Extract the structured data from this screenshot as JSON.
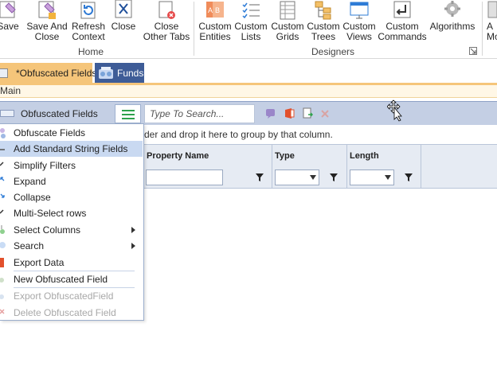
{
  "ribbon": {
    "buttons": [
      {
        "id": "save",
        "label": "Save",
        "icon": "save-icon"
      },
      {
        "id": "save-close",
        "label": "Save And Close",
        "icon": "save-close-icon"
      },
      {
        "id": "refresh",
        "label": "Refresh Context",
        "icon": "refresh-icon"
      },
      {
        "id": "close",
        "label": "Close",
        "icon": "close-icon"
      },
      {
        "id": "close-other",
        "label": "Close Other Tabs",
        "icon": "close-other-tabs-icon"
      },
      {
        "id": "custom-entities",
        "label": "Custom Entities",
        "icon": "abc-icon"
      },
      {
        "id": "custom-lists",
        "label": "Custom Lists",
        "icon": "checklist-icon"
      },
      {
        "id": "custom-grids",
        "label": "Custom Grids",
        "icon": "grid-icon"
      },
      {
        "id": "custom-trees",
        "label": "Custom Trees",
        "icon": "tree-icon"
      },
      {
        "id": "custom-views",
        "label": "Custom Views",
        "icon": "views-icon"
      },
      {
        "id": "custom-commands",
        "label": "Custom Commands",
        "icon": "command-icon"
      },
      {
        "id": "algorithms",
        "label": "Algorithms",
        "icon": "gear-icon"
      },
      {
        "id": "auto-mo",
        "label": "A Mo",
        "icon": "auto-icon"
      }
    ],
    "groups": {
      "home": "Home",
      "designers": "Designers"
    }
  },
  "doc_tabs": [
    {
      "label": "*Obfuscated Fields",
      "active": true,
      "icon": "document-icon"
    },
    {
      "label": "Funds",
      "active": false,
      "icon": "funds-icon"
    }
  ],
  "sub_tab": "Main",
  "panel": {
    "title": "Obfuscated Fields",
    "search_placeholder": "Type To Search..."
  },
  "grid": {
    "group_hint": "der and drop it here to group by that column.",
    "columns": [
      {
        "title": "Property Name"
      },
      {
        "title": "Type"
      },
      {
        "title": "Length"
      }
    ]
  },
  "menu": {
    "items": [
      {
        "label": "Obfuscate Fields",
        "disabled": false,
        "highlighted": false,
        "submenu": false
      },
      {
        "label": "Add Standard String Fields",
        "disabled": false,
        "highlighted": true,
        "submenu": false
      },
      {
        "label": "Simplify Filters",
        "disabled": false,
        "highlighted": false,
        "submenu": false
      },
      {
        "label": "Expand",
        "disabled": false,
        "highlighted": false,
        "submenu": false
      },
      {
        "label": "Collapse",
        "disabled": false,
        "highlighted": false,
        "submenu": false
      },
      {
        "label": "Multi-Select rows",
        "disabled": false,
        "highlighted": false,
        "submenu": false
      },
      {
        "label": "Select Columns",
        "disabled": false,
        "highlighted": false,
        "submenu": true
      },
      {
        "label": "Search",
        "disabled": false,
        "highlighted": false,
        "submenu": true
      },
      {
        "label": "Export Data",
        "disabled": false,
        "highlighted": false,
        "submenu": false
      },
      {
        "label": "New Obfuscated Field",
        "disabled": false,
        "highlighted": false,
        "submenu": false
      },
      {
        "label": "Export ObfuscatedField",
        "disabled": true,
        "highlighted": false,
        "submenu": false
      },
      {
        "label": "Delete Obfuscated Field",
        "disabled": true,
        "highlighted": false,
        "submenu": false
      }
    ]
  },
  "colors": {
    "accent_tab": "#f5c57a",
    "toolbar": "#c4cfe4",
    "menu_highlight": "#c9d9f1",
    "hamburger": "#2da24b"
  }
}
